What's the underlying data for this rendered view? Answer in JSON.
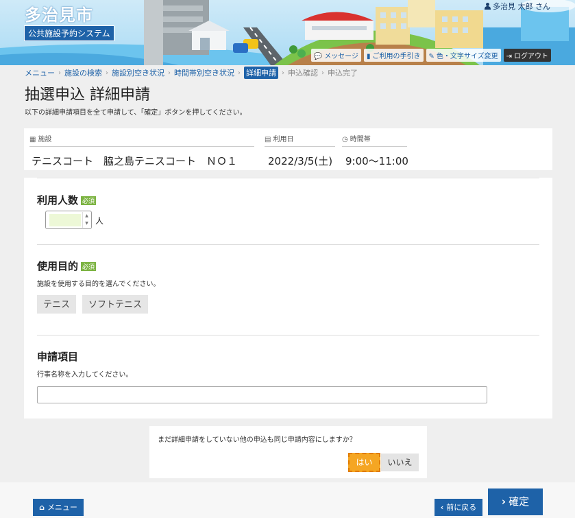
{
  "header": {
    "city_name": "多治見市",
    "system_name": "公共施設予約システム",
    "user_name": "多治見 太郎 さん",
    "links": [
      {
        "icon": "message-icon",
        "label": "メッセージ"
      },
      {
        "icon": "book-icon",
        "label": "ご利用の手引き"
      },
      {
        "icon": "brush-icon",
        "label": "色・文字サイズ変更"
      },
      {
        "icon": "logout-icon",
        "label": "ログアウト"
      }
    ]
  },
  "breadcrumb": [
    {
      "label": "メニュー",
      "state": "link"
    },
    {
      "label": "施設の検索",
      "state": "link"
    },
    {
      "label": "施設別空き状況",
      "state": "link"
    },
    {
      "label": "時間帯別空き状況",
      "state": "link"
    },
    {
      "label": "詳細申請",
      "state": "current"
    },
    {
      "label": "申込確認",
      "state": "disabled"
    },
    {
      "label": "申込完了",
      "state": "disabled"
    }
  ],
  "page": {
    "title": "抽選申込 詳細申請",
    "description": "以下の詳細申請項目を全て申請して、「確定」ボタンを押してください。"
  },
  "summary": {
    "facility_label": "施設",
    "facility_value": "テニスコート　脇之島テニスコート　ＮＯ１",
    "date_label": "利用日",
    "date_value": "2022/3/5(土)",
    "time_label": "時間帯",
    "time_value": "9:00～11:00"
  },
  "form": {
    "people": {
      "title": "利用人数",
      "required": "必須",
      "value": "",
      "unit": "人"
    },
    "purpose": {
      "title": "使用目的",
      "required": "必須",
      "help": "施設を使用する目的を選んでください。",
      "options": [
        "テニス",
        "ソフトテニス"
      ]
    },
    "application_item": {
      "title": "申請項目",
      "help": "行事名称を入力してください。",
      "value": ""
    }
  },
  "confirm": {
    "question": "まだ詳細申請をしていない他の申込も同じ申請内容にしますか？",
    "yes": "はい",
    "no": "いいえ"
  },
  "footer": {
    "menu": "メニュー",
    "back": "前に戻る",
    "ok": "確定"
  },
  "colors": {
    "primary": "#1e62a8",
    "required_badge": "#7cb342",
    "yes_button": "#f5a623",
    "logout": "#333333"
  }
}
